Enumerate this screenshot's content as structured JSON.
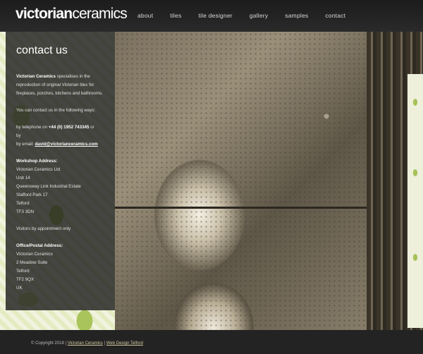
{
  "site": {
    "logo_bold": "victorian",
    "logo_light": "ceramics"
  },
  "nav": {
    "items": [
      "about",
      "tiles",
      "tile designer",
      "gallery",
      "samples",
      "contact"
    ]
  },
  "contact": {
    "title": "contact us",
    "intro_brand": "Victorian Ceramics",
    "intro_text": " specialises in the reproduction of original Victorian tiles for fireplaces, porches, kitchens and bathrooms.",
    "contact_ways": "You can contact us in the following ways:",
    "phone_prefix": "by telephone on ",
    "phone": "+44 (0) 1952 743345",
    "phone_suffix": " or",
    "by_line": "by",
    "email_prefix": "by email: ",
    "email": "david@victorianceramics.com",
    "workshop_heading": "Workshop Address:",
    "workshop_lines": [
      "Victorian Ceramics Ltd",
      "Unit 14",
      "Queensway Link Industrial Estate",
      "Stafford Park 17",
      "Telford",
      "TF3 3DN"
    ],
    "visitors_note": "Visitors by appointment only",
    "postal_heading": "Office/Postal Address:",
    "postal_lines": [
      "Victorian Ceramics",
      "2 Meadow Suite",
      "Telford",
      "TF2 9QX",
      "UK"
    ]
  },
  "footer": {
    "copyright": "© Copyright 2018 | ",
    "link1": "Victorian Ceramics",
    "sep": " | ",
    "link2": "Web Design Telford"
  }
}
